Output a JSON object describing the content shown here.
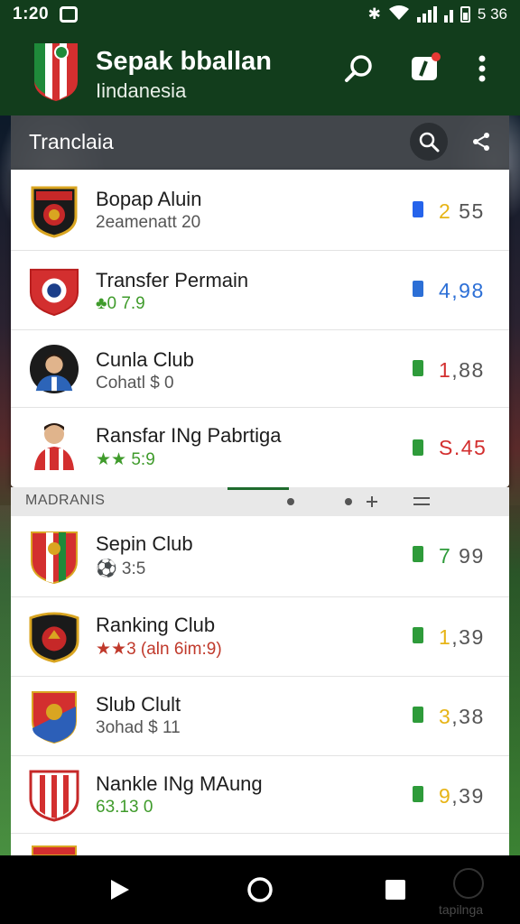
{
  "status_bar": {
    "time": "1:20",
    "right_text": "ᗗ",
    "battery_label": "5 36"
  },
  "app_bar": {
    "title": "Sepak bballan",
    "subtitle": "Iindanesia",
    "icons": [
      "search-icon",
      "notification-icon",
      "more-icon"
    ]
  },
  "section": {
    "title": "Tranclaia"
  },
  "list_top": [
    {
      "name": "Bopap Aluin",
      "sub": "2eamenatt   20",
      "sub_color": "#555555",
      "value_lead": "2",
      "value_rest": " 55",
      "lead_color": "#e7b416",
      "indicator_color": "#2563eb",
      "badge": "club-crest-red-black"
    },
    {
      "name": "Transfer Permain",
      "sub": "♣0 7.9",
      "sub_color": "#3f9b2b",
      "value_lead": "4,98",
      "value_rest": "",
      "lead_color": "#2c6fd6",
      "indicator_color": "#2c6fd6",
      "badge": "club-crest-red"
    },
    {
      "name": "Cunla Club",
      "sub": "Cohatl  $  0",
      "sub_color": "#555555",
      "value_lead": "1",
      "value_rest": ",88",
      "lead_color": "#d32f2f",
      "indicator_color": "#2e9b3a",
      "badge": "player-avatar-blue"
    },
    {
      "name": "Ransfar INg Pabrtiga",
      "sub": "★★ 5:9",
      "sub_color": "#3f9b2b",
      "value_lead": "S.45",
      "value_rest": "",
      "lead_color": "#d32f2f",
      "indicator_color": "#2e9b3a",
      "badge": "player-avatar-red"
    }
  ],
  "filter_strip": {
    "label": "MADRANIS"
  },
  "list_bottom": [
    {
      "name": "Sepin Club",
      "sub": "⚽ 3:5",
      "sub_color": "#555555",
      "value_lead": "7",
      "value_rest": " 99",
      "lead_color": "#2e9b3a",
      "indicator_color": "#2e9b3a",
      "badge": "club-crest-red-green"
    },
    {
      "name": "Ranking Club",
      "sub": "★★3 (aln 6im:9)",
      "sub_color": "#c0392b",
      "value_lead": "1",
      "value_rest": ",39",
      "lead_color": "#e7b416",
      "indicator_color": "#2e9b3a",
      "badge": "club-crest-black-red"
    },
    {
      "name": "Slub Clult",
      "sub": "3ohad  $  11",
      "sub_color": "#555555",
      "value_lead": "3",
      "value_rest": ",38",
      "lead_color": "#e7b416",
      "indicator_color": "#2e9b3a",
      "badge": "club-crest-blue-red"
    },
    {
      "name": "Nankle INg MAung",
      "sub": "63.13 0",
      "sub_color": "#3f9b2b",
      "value_lead": "9",
      "value_rest": ",39",
      "lead_color": "#e7b416",
      "indicator_color": "#2e9b3a",
      "badge": "club-crest-striped"
    }
  ],
  "nav_bar": {
    "extra_label": "tapilnga"
  },
  "colors": {
    "app_bar": "#123d1c",
    "accent_green": "#1e6b2d"
  }
}
